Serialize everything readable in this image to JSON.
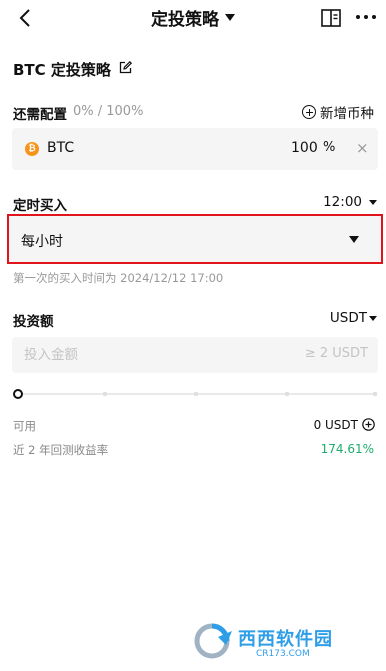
{
  "header": {
    "title": "定投策略",
    "back_icon": "chevron-left-icon",
    "guide_icon": "book-icon",
    "more_icon": "more-dots-icon"
  },
  "strategy": {
    "name": "BTC 定投策略",
    "edit_icon": "edit-icon"
  },
  "allocation": {
    "label": "还需配置",
    "progress": "0% / 100%",
    "add_label": "新增币种",
    "coins": [
      {
        "symbol": "BTC",
        "icon": "btc-icon",
        "percent": "100",
        "unit": "%",
        "remove": "×"
      }
    ]
  },
  "schedule": {
    "label": "定时买入",
    "time": "12:00",
    "frequency": "每小时",
    "first_buy_text": "第一次的买入时间为 2024/12/12 17:00"
  },
  "investment": {
    "label": "投资额",
    "currency": "USDT",
    "amount_placeholder": "投入金额",
    "min_hint": "≥ 2 USDT",
    "slider_value_percent": 0,
    "available_label": "可用",
    "available_value": "0 USDT",
    "backtest_label": "近 2 年回测收益率",
    "backtest_value": "174.61%"
  },
  "watermark": {
    "brand": "西西软件园",
    "domain": "CR173.COM"
  },
  "colors": {
    "highlight_border": "#e0151b",
    "positive": "#1cad6b",
    "btc": "#f7931a",
    "watermark": "#2f9ee8"
  }
}
